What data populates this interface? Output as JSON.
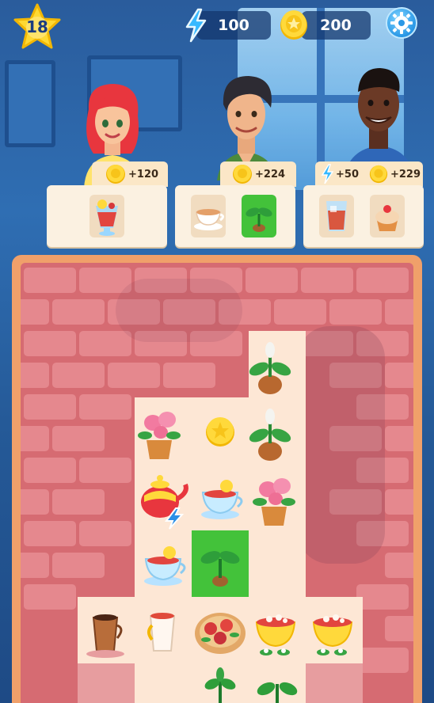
{
  "hud": {
    "level": "18",
    "energy": "100",
    "coins": "200",
    "icons": [
      "star-level-icon",
      "lightning-energy-icon",
      "coin-icon",
      "gear-icon"
    ]
  },
  "orders": [
    {
      "customer": "red-haired-woman",
      "rewards": [
        {
          "icon": "coin-icon",
          "text": "+120"
        }
      ],
      "items": [
        {
          "name": "lemon-iced-tea",
          "ready": false
        }
      ]
    },
    {
      "customer": "dark-haired-man",
      "rewards": [
        {
          "icon": "coin-icon",
          "text": "+224"
        }
      ],
      "items": [
        {
          "name": "tea-cup",
          "ready": false
        },
        {
          "name": "sprout",
          "ready": true
        }
      ]
    },
    {
      "customer": "smiling-man",
      "rewards": [
        {
          "icon": "lightning-energy-icon",
          "text": "+50"
        },
        {
          "icon": "coin-icon",
          "text": "+229"
        }
      ],
      "items": [
        {
          "name": "iced-drink",
          "ready": false
        },
        {
          "name": "cupcake",
          "ready": false
        }
      ]
    }
  ],
  "board_items": [
    "sprout-bulb",
    "rose-pot",
    "gold-coin",
    "sprout-bulb",
    "teapot-energy",
    "lemon-tea-cup",
    "rose-pot",
    "lemon-tea-cup",
    "sprout",
    "coffee-cup",
    "tea-cup-small",
    "roses-plate",
    "tea-cup-flowers",
    "tea-cup-flowers",
    "plant",
    "plant"
  ],
  "colors": {
    "board_bg": "#d66b72",
    "board_frame": "#f0a06a",
    "cell_light": "#fde7d5",
    "ready_green": "#43c23a",
    "order_card": "#fbf1e1",
    "hud_pill": "#14376e"
  }
}
